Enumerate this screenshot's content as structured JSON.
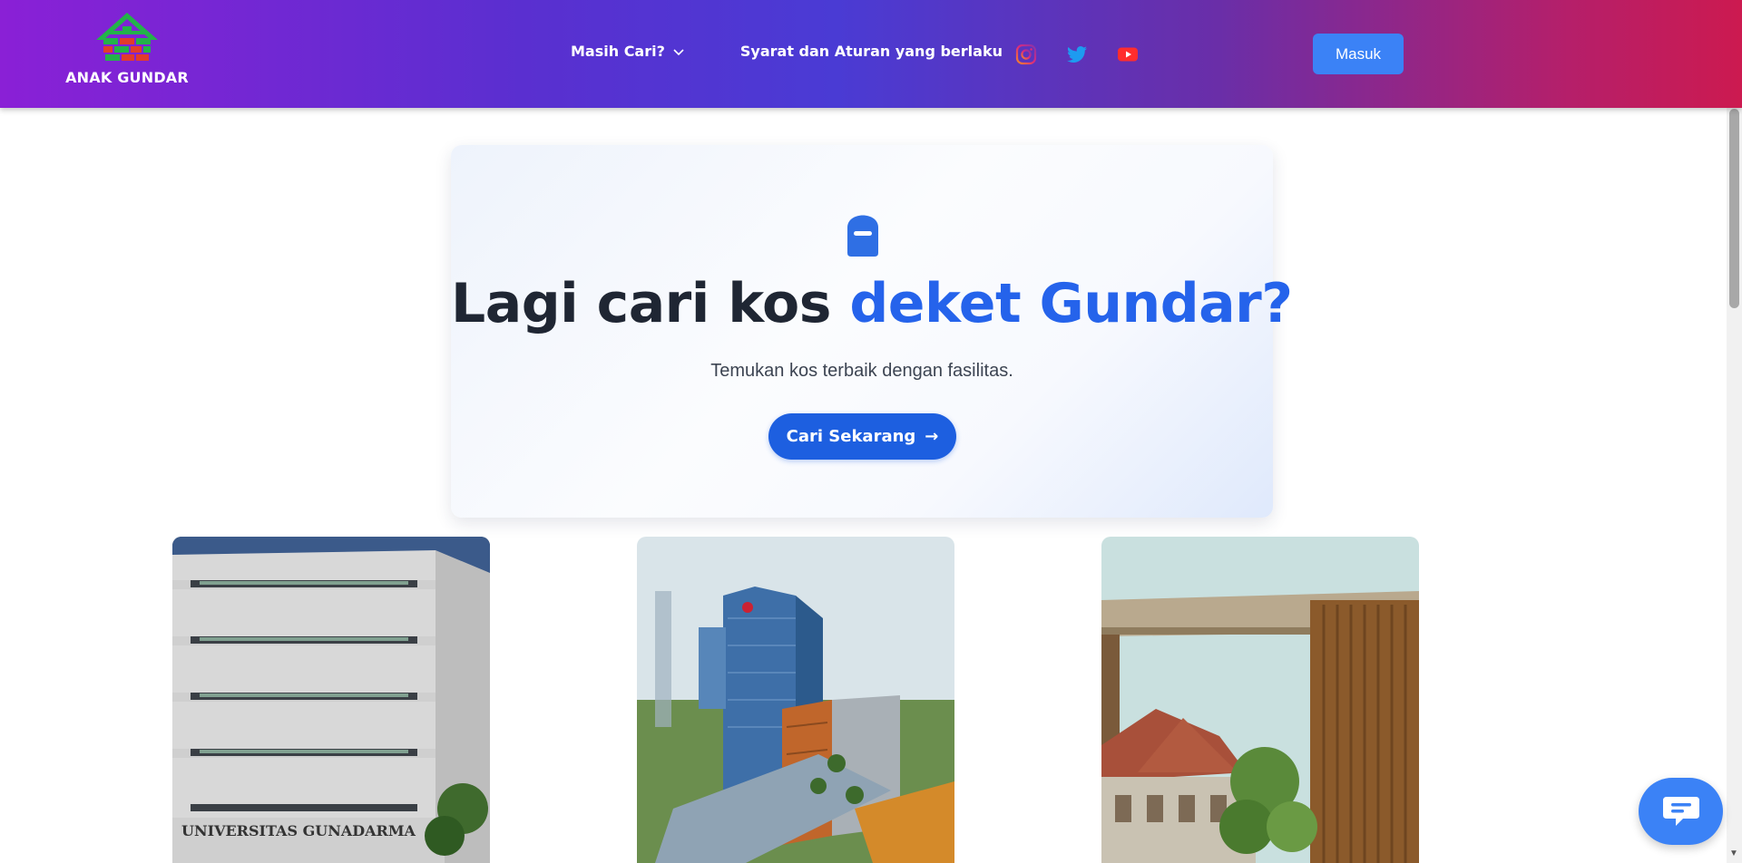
{
  "brand": {
    "name": "ANAK GUNDAR"
  },
  "nav": {
    "menu_label": "Masih Cari?",
    "rules_label": "Syarat dan Aturan yang berlaku",
    "socials": [
      "instagram-icon",
      "twitter-icon",
      "youtube-icon"
    ],
    "login_label": "Masuk"
  },
  "hero": {
    "title_main": "Lagi cari kos ",
    "title_accent": "deket Gundar?",
    "subtitle": "Temukan kos terbaik dengan fasilitas.",
    "cta_label": "Cari Sekarang",
    "cta_arrow": "→"
  },
  "campus_cards": [
    {
      "sign_text": "UNIVERSITAS GUNADARMA"
    },
    {
      "sign_text": ""
    },
    {
      "sign_text": ""
    }
  ],
  "colors": {
    "accent": "#2563eb",
    "button": "#3b82f6",
    "title": "#1f2633"
  }
}
